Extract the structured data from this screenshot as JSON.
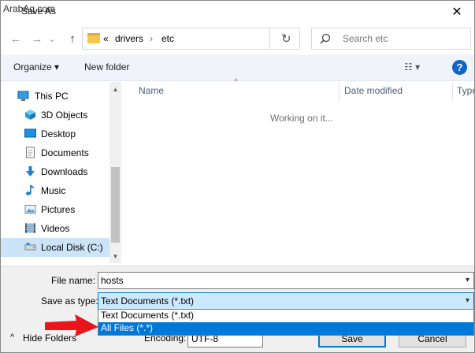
{
  "window": {
    "watermark": "ArabAq.com",
    "title": "Save As",
    "close_glyph": "✕"
  },
  "navigation": {
    "back_glyph": "←",
    "forward_glyph": "→",
    "recent_glyph": "⌄",
    "up_glyph": "↑",
    "breadcrumb": [
      "«",
      "drivers",
      "›",
      "etc"
    ],
    "refresh_glyph": "↻",
    "search_placeholder": "Search etc"
  },
  "toolbar": {
    "organize_label": "Organize ▾",
    "new_folder_label": "New folder",
    "view_glyph": "☷ ▾",
    "help_glyph": "?"
  },
  "sidebar": {
    "items": [
      {
        "label": "This PC",
        "icon": "this-pc-icon"
      },
      {
        "label": "3D Objects",
        "icon": "3d-objects-icon"
      },
      {
        "label": "Desktop",
        "icon": "desktop-icon"
      },
      {
        "label": "Documents",
        "icon": "documents-icon"
      },
      {
        "label": "Downloads",
        "icon": "downloads-icon"
      },
      {
        "label": "Music",
        "icon": "music-icon"
      },
      {
        "label": "Pictures",
        "icon": "pictures-icon"
      },
      {
        "label": "Videos",
        "icon": "videos-icon"
      },
      {
        "label": "Local Disk (C:)",
        "icon": "local-disk-icon"
      }
    ],
    "selected": "Local Disk (C:)"
  },
  "file_list": {
    "columns": [
      "Name",
      "Date modified",
      "Type"
    ],
    "status": "Working on it..."
  },
  "form": {
    "file_name_label": "File name:",
    "file_name_value": "hosts",
    "save_type_label": "Save as type:",
    "save_type_value": "Text Documents (*.txt)",
    "save_type_options": [
      "Text Documents (*.txt)",
      "All Files  (*.*)"
    ],
    "highlighted_option": "All Files  (*.*)",
    "hide_folders_label": "Hide Folders",
    "encoding_label": "Encoding:",
    "encoding_value": "UTF-8",
    "save_label": "Save",
    "cancel_label": "Cancel"
  },
  "colors": {
    "accent": "#0078d7",
    "annotation_arrow": "#e8151b",
    "selection_bg": "#cce4f7"
  }
}
